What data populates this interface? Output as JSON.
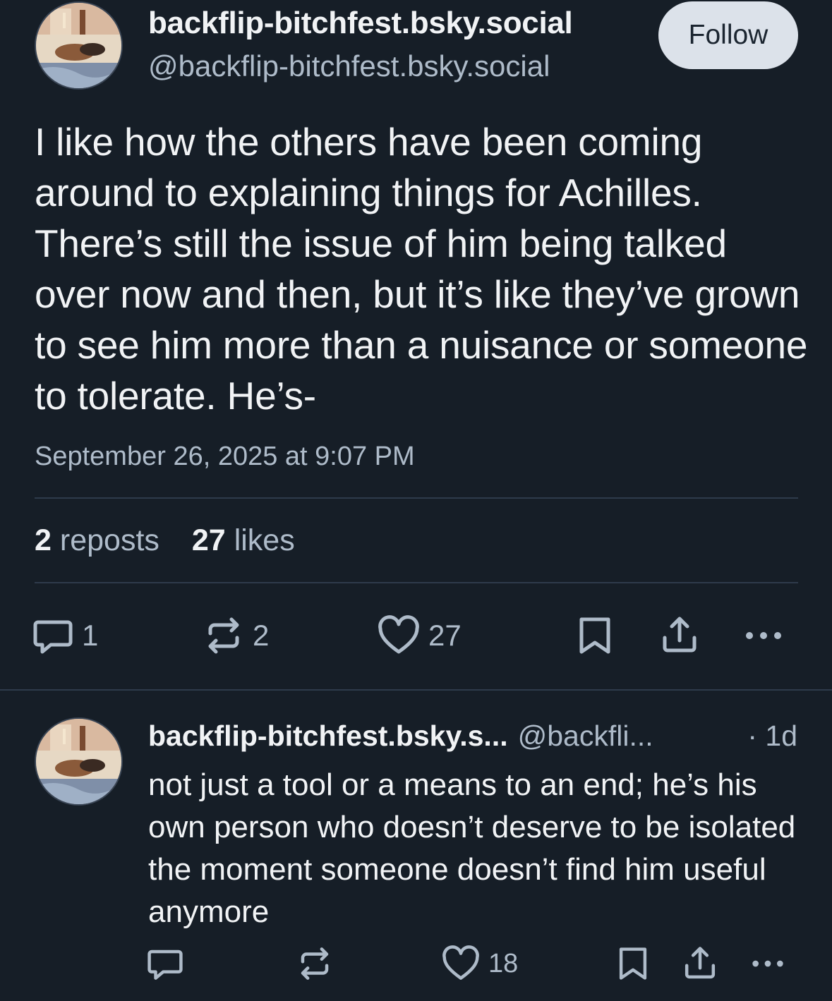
{
  "post": {
    "display_name": "backflip-bitchfest.bsky.social",
    "handle": "@backflip-bitchfest.bsky.social",
    "follow_label": "Follow",
    "text": "I like how the others have been coming around to explaining things for Achilles. There’s still the issue of him being talked over now and then, but it’s like they’ve grown to see him more than a nuisance or someone to tolerate. He’s-",
    "timestamp": "September 26, 2025 at 9:07 PM",
    "stats": {
      "reposts_count": "2",
      "reposts_label": "reposts",
      "likes_count": "27",
      "likes_label": "likes"
    },
    "actions": {
      "reply_count": "1",
      "repost_count": "2",
      "like_count": "27"
    }
  },
  "reply": {
    "display_name": "backflip-bitchfest.bsky.s...",
    "handle": "@backfli...",
    "time": "· 1d",
    "text": "not just a tool or a means to an end; he’s his own person who doesn’t deserve to be isolated the moment someone doesn’t find him useful anymore",
    "actions": {
      "reply_count": "",
      "repost_count": "",
      "like_count": "18"
    }
  },
  "icons": [
    "reply-icon",
    "repost-icon",
    "like-icon",
    "bookmark-icon",
    "share-icon",
    "more-icon"
  ],
  "colors": {
    "background": "#161e27",
    "text": "#f1f3f5",
    "muted": "#aebbc9",
    "divider": "#2e3b4b",
    "follow_bg": "#dce2ea"
  }
}
